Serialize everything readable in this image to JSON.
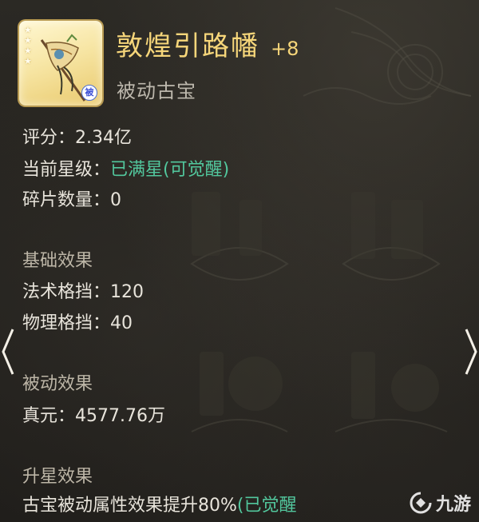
{
  "item": {
    "name": "敦煌引路幡",
    "level": "+8",
    "type": "被动古宝",
    "badge": "被",
    "stars": 4,
    "icon": "banner-flag-icon"
  },
  "stats": {
    "score_label": "评分：",
    "score_value": "2.34亿",
    "star_label": "当前星级：",
    "star_value": "已满星(可觉醒)",
    "fragment_label": "碎片数量：",
    "fragment_value": "0"
  },
  "base_effect": {
    "title": "基础效果",
    "lines": [
      {
        "label": "法术格挡：",
        "value": "120"
      },
      {
        "label": "物理格挡：",
        "value": "40"
      }
    ]
  },
  "passive_effect": {
    "title": "被动效果",
    "lines": [
      {
        "label": "真元：",
        "value": "4577.76万"
      }
    ]
  },
  "upgrade_effect": {
    "title": "升星效果",
    "text": "古宝被动属性效果提升80%",
    "suffix": "(已觉醒"
  },
  "watermark": {
    "text": "九游"
  },
  "colors": {
    "gold": "#f6d67a",
    "green": "#52c79d",
    "text": "#e8e4db",
    "muted": "#bdb6a7"
  }
}
